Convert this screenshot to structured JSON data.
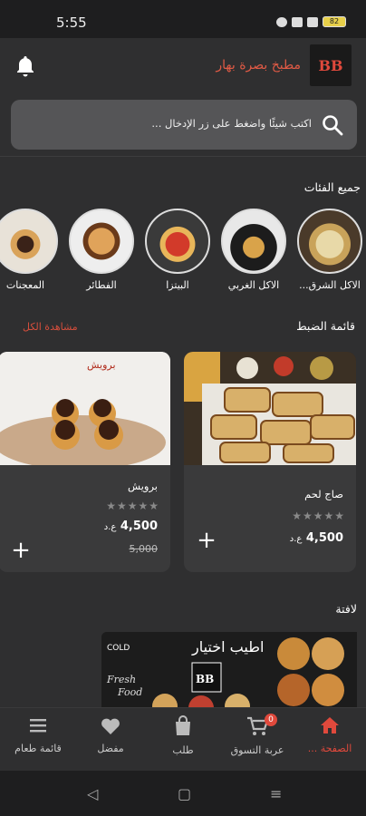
{
  "status": {
    "time": "5:55",
    "battery": "82"
  },
  "header": {
    "brand_name": "مطبخ بصرة بهار",
    "logo_text": "BB"
  },
  "search": {
    "placeholder": "اكتب شيئًا واضغط على زر الإدخال ..."
  },
  "categories": {
    "title": "جميع الفئات",
    "items": [
      {
        "label": "الاكل الشرق..."
      },
      {
        "label": "الاكل الغربي"
      },
      {
        "label": "البيتزا"
      },
      {
        "label": "الفطائر"
      },
      {
        "label": "المعجنات"
      }
    ]
  },
  "offers": {
    "title": "قائمة الضبط",
    "see_all": "مشاهدة الكل",
    "items": [
      {
        "name": "صاج لحم",
        "stars": "★★★★★",
        "price": "4,500",
        "currency": "ع.د"
      },
      {
        "name": "برويش",
        "stars": "★★★★★",
        "price": "4,500",
        "currency": "ع.د",
        "old_price": "5,000",
        "image_caption": "برويش"
      }
    ]
  },
  "banner_section": {
    "title": "لافتة",
    "banner_text": "اطيب اختيار"
  },
  "bottom_nav": {
    "items": [
      {
        "label": "الصفحة ..."
      },
      {
        "label": "عربة التسوق",
        "badge": "0"
      },
      {
        "label": "طلب"
      },
      {
        "label": "مفضل"
      },
      {
        "label": "قائمة طعام"
      }
    ]
  },
  "colors": {
    "accent": "#e0493c",
    "background": "#2f2f30",
    "card": "#3a3a3b"
  },
  "icons": [
    "bell-icon",
    "search-icon",
    "home-icon",
    "cart-icon",
    "bag-icon",
    "heart-icon",
    "menu-icon",
    "plus-icon"
  ]
}
